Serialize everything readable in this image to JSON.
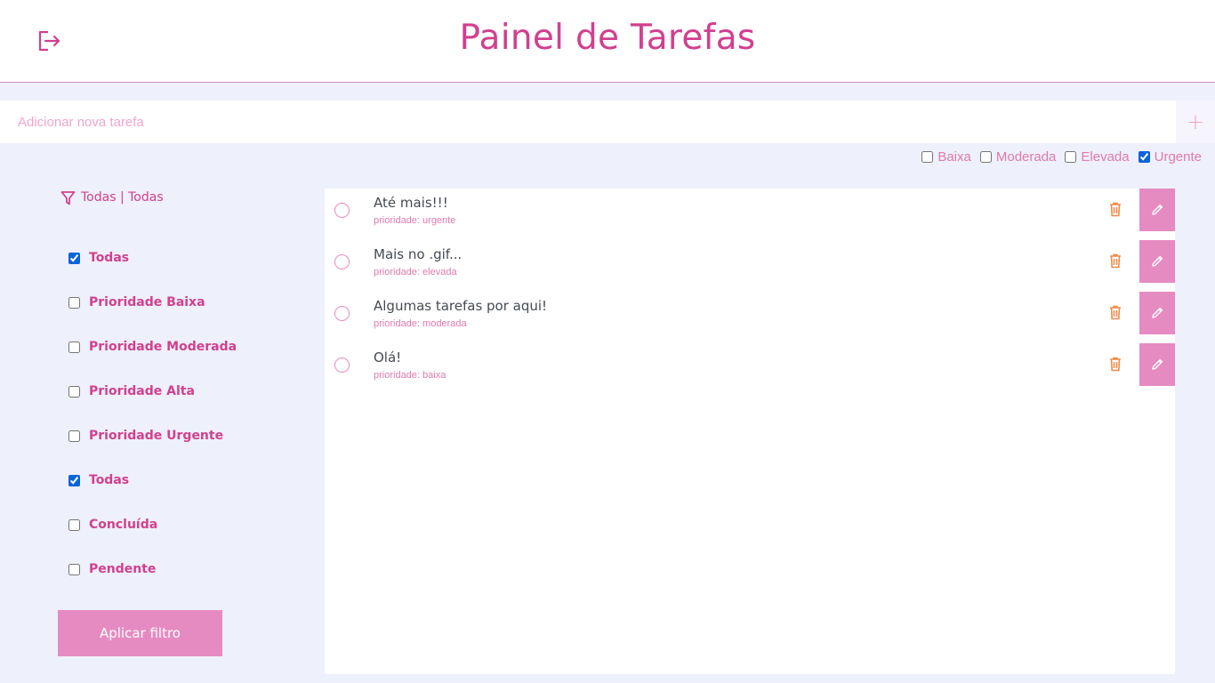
{
  "header": {
    "title": "Painel de Tarefas",
    "logout_icon": "logout-icon"
  },
  "new_task": {
    "placeholder": "Adicionar nova tarefa",
    "value": "",
    "add_icon": "plus-icon",
    "add_label": "+"
  },
  "priority_options": [
    {
      "label": "Baixa",
      "checked": false
    },
    {
      "label": "Moderada",
      "checked": false
    },
    {
      "label": "Elevada",
      "checked": false
    },
    {
      "label": "Urgente",
      "checked": true
    }
  ],
  "filter": {
    "summary": "Todas | Todas",
    "icon": "filter-icon",
    "items": [
      {
        "label": "Todas",
        "checked": true
      },
      {
        "label": "Prioridade Baixa",
        "checked": false
      },
      {
        "label": "Prioridade Moderada",
        "checked": false
      },
      {
        "label": "Prioridade Alta",
        "checked": false
      },
      {
        "label": "Prioridade Urgente",
        "checked": false
      },
      {
        "label": "Todas",
        "checked": true
      },
      {
        "label": "Concluída",
        "checked": false
      },
      {
        "label": "Pendente",
        "checked": false
      }
    ],
    "apply_label": "Aplicar filtro"
  },
  "tasks": [
    {
      "name": "Até mais!!!",
      "priority": "prioridade: urgente"
    },
    {
      "name": "Mais no .gif...",
      "priority": "prioridade: elevada"
    },
    {
      "name": "Algumas tarefas por aqui!",
      "priority": "prioridade: moderada"
    },
    {
      "name": "Olá!",
      "priority": "prioridade: baixa"
    }
  ],
  "colors": {
    "accent": "#d1408f",
    "button": "#e68bc1",
    "trash": "#f08c4a",
    "background": "#eef0fb"
  }
}
